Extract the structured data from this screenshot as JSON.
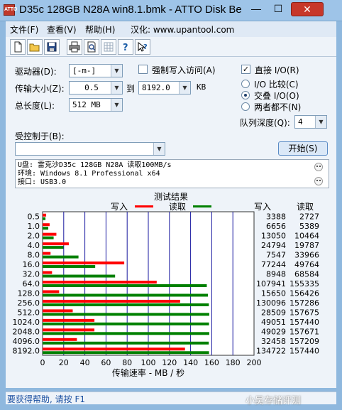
{
  "window": {
    "title": "D35c 128GB N28A win8.1.bmk - ATTO Disk Be",
    "app_icon_text": "ATTO",
    "minimize": "—",
    "maximize": "☐",
    "close": "✕"
  },
  "menu": {
    "file": "文件(F)",
    "view": "查看(V)",
    "help": "帮助(H)",
    "localize": "汉化: www.upantool.com"
  },
  "toolbar": {
    "icons": [
      "new-document-icon",
      "open-folder-icon",
      "save-icon",
      "print-icon",
      "print-preview-icon",
      "grid-icon",
      "help-icon",
      "context-help-icon"
    ]
  },
  "settings": {
    "drive_label": "驱动器(D):",
    "drive_value": "[-m-]",
    "transfer_size_label": "传输大小(Z):",
    "transfer_from": "0.5",
    "transfer_to_label": "到",
    "transfer_to": "8192.0",
    "transfer_unit": "KB",
    "total_length_label": "总长度(L):",
    "total_length_value": "512 MB",
    "force_write_label": "强制写入访问(A)",
    "force_write_checked": false,
    "direct_io_label": "直接 I/O(R)",
    "direct_io_checked": true,
    "io_compare_label": "I/O 比较(C)",
    "io_overlap_label": "交叠 I/O(O)",
    "neither_label": "两者都不(N)",
    "selected_mode": "io_overlap",
    "queue_depth_label": "队列深度(Q):",
    "queue_depth_value": "4",
    "controlled_by_label": "受控制于(B):",
    "controlled_by_value": "",
    "start_button": "开始(S)"
  },
  "description": {
    "line1": "U盘: 雷克沙D35c 128GB N28A 读取100MB/s",
    "line2": "环境: Windows 8.1 Professional x64",
    "line3": "接口: USB3.0"
  },
  "results": {
    "title": "测试结果",
    "write_legend": "写入",
    "read_legend": "读取",
    "col_write": "写入",
    "col_read": "读取",
    "write_color": "#ff0000",
    "read_color": "#008000"
  },
  "chart_data": {
    "type": "bar",
    "orientation": "horizontal",
    "categories": [
      "0.5",
      "1.0",
      "2.0",
      "4.0",
      "8.0",
      "16.0",
      "32.0",
      "64.0",
      "128.0",
      "256.0",
      "512.0",
      "1024.0",
      "2048.0",
      "4096.0",
      "8192.0"
    ],
    "series": [
      {
        "name": "写入",
        "values": [
          3388,
          6656,
          13050,
          24794,
          7547,
          77244,
          8948,
          107941,
          15650,
          130096,
          28509,
          49051,
          49029,
          32458,
          134722
        ]
      },
      {
        "name": "读取",
        "values": [
          2727,
          5389,
          10464,
          19787,
          33966,
          49764,
          68584,
          155335,
          156426,
          157286,
          157675,
          157440,
          157671,
          157209,
          157440
        ]
      }
    ],
    "xlabel": "传输速率 - MB / 秒",
    "xticks": [
      "0",
      "20",
      "40",
      "60",
      "80",
      "100",
      "120",
      "140",
      "160",
      "180",
      "200"
    ],
    "xlim": [
      0,
      200
    ],
    "value_unit": "KB/s",
    "grid": true
  },
  "status": {
    "help_text": "要获得帮助, 请按 F1",
    "watermark": "小吴存储评测"
  }
}
